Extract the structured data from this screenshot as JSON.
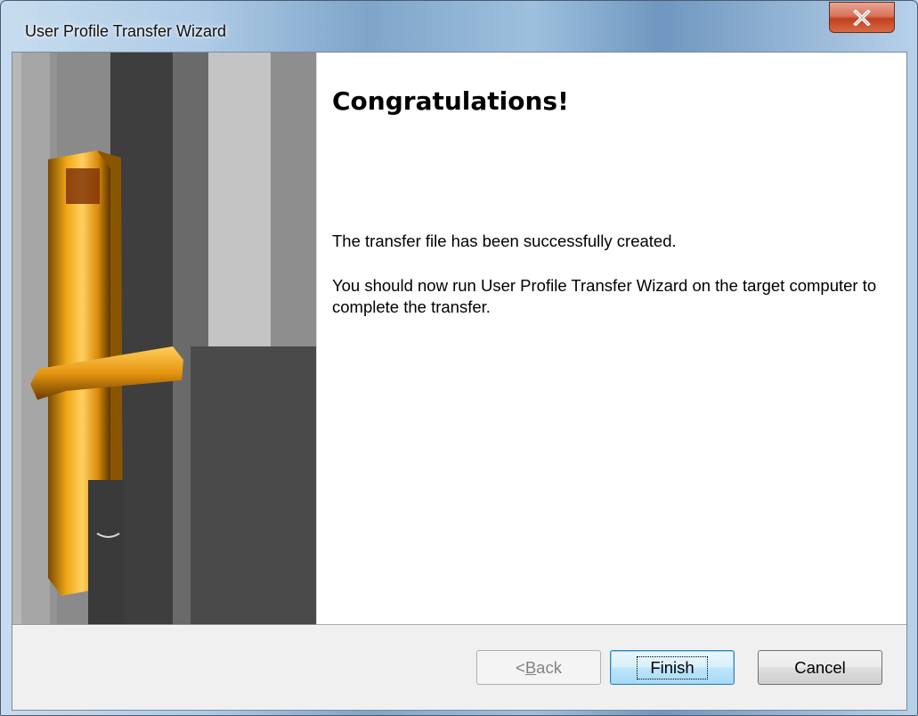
{
  "window": {
    "title": "User Profile Transfer Wizard",
    "close_label": "X"
  },
  "page": {
    "heading": "Congratulations!",
    "paragraph1": "The transfer file has been successfully created.",
    "paragraph2": "You should now run User Profile Transfer Wizard on the target computer to complete the transfer."
  },
  "buttons": {
    "back": {
      "prefix": "< ",
      "mnemonic": "B",
      "rest": "ack",
      "enabled": false
    },
    "finish": {
      "label": "Finish",
      "default": true
    },
    "cancel": {
      "label": "Cancel"
    }
  },
  "icons": {
    "close": "close-icon",
    "sidebar_image": "door-lock-handle-image"
  },
  "colors": {
    "close_button": "#c2401f",
    "default_button_border": "#3c7fb1",
    "content_background": "#ffffff",
    "dialog_background": "#f0f0f0"
  }
}
